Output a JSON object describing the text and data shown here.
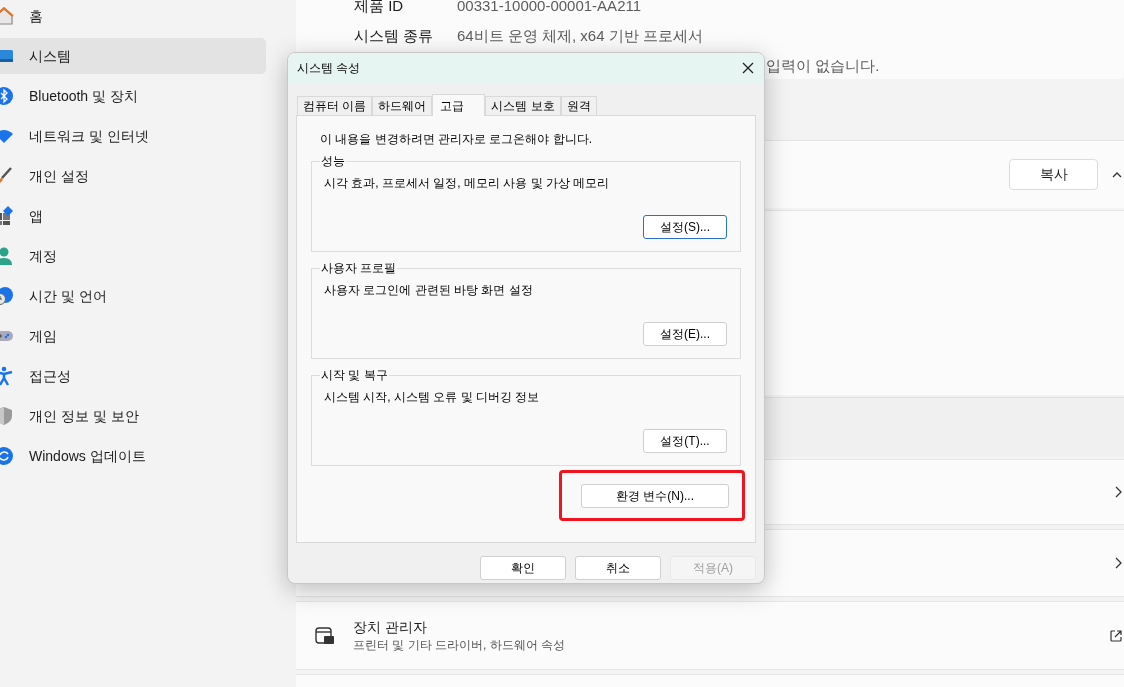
{
  "sidebar": {
    "items": [
      {
        "label": "홈",
        "selected": false
      },
      {
        "label": "시스템",
        "selected": true
      },
      {
        "label": "Bluetooth 및 장치",
        "selected": false
      },
      {
        "label": "네트워크 및 인터넷",
        "selected": false
      },
      {
        "label": "개인 설정",
        "selected": false
      },
      {
        "label": "앱",
        "selected": false
      },
      {
        "label": "계정",
        "selected": false
      },
      {
        "label": "시간 및 언어",
        "selected": false
      },
      {
        "label": "게임",
        "selected": false
      },
      {
        "label": "접근성",
        "selected": false
      },
      {
        "label": "개인 정보 및 보안",
        "selected": false
      },
      {
        "label": "Windows 업데이트",
        "selected": false
      }
    ]
  },
  "specs": [
    {
      "label": "제품 ID",
      "value": "00331-10000-00001-AA211"
    },
    {
      "label": "시스템 종류",
      "value": "64비트 운영 체제, x64 기반 프로세서"
    }
  ],
  "hidden_row_visible_text": "입력이 없습니다.",
  "copy_button": "복사",
  "device_manager": {
    "title": "장치 관리자",
    "subtitle": "프린터 및 기타 드라이버, 하드웨어 속성"
  },
  "dialog": {
    "title": "시스템 속성",
    "tabs": [
      {
        "label": "컴퓨터 이름",
        "selected": false
      },
      {
        "label": "하드웨어",
        "selected": false
      },
      {
        "label": "고급",
        "selected": true
      },
      {
        "label": "시스템 보호",
        "selected": false
      },
      {
        "label": "원격",
        "selected": false
      }
    ],
    "notice": "이 내용을 변경하려면 관리자로 로그온해야 합니다.",
    "groups": [
      {
        "title": "성능",
        "description": "시각 효과, 프로세서 일정, 메모리 사용 및 가상 메모리",
        "button": "설정(S)...",
        "focused": true
      },
      {
        "title": "사용자 프로필",
        "description": "사용자 로그인에 관련된 바탕 화면 설정",
        "button": "설정(E)...",
        "focused": false
      },
      {
        "title": "시작 및 복구",
        "description": "시스템 시작, 시스템 오류 및 디버깅 정보",
        "button": "설정(T)...",
        "focused": false
      }
    ],
    "env_button": {
      "label": "환경 변수(N)...",
      "highlighted": true
    },
    "buttons": [
      {
        "label": "확인",
        "disabled": false
      },
      {
        "label": "취소",
        "disabled": false
      },
      {
        "label": "적용(A)",
        "disabled": true
      }
    ]
  }
}
